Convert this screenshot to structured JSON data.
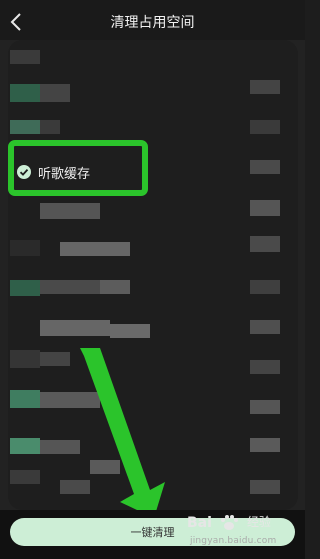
{
  "header": {
    "title": "清理占用空间"
  },
  "list": {
    "cache_item_label": "听歌缓存"
  },
  "footer": {
    "clean_button_label": "一键清理"
  },
  "watermark": {
    "brand": "Bai",
    "brand_suffix": "经验",
    "url": "jingyan.baidu.com"
  },
  "colors": {
    "accent_green": "#2bc42b",
    "button_background": "#cdeed6",
    "page_background": "#1d1d1d"
  },
  "icons": [
    "back-arrow-icon",
    "checkmark-icon",
    "annotation-arrow-icon",
    "baidu-paw-icon"
  ]
}
